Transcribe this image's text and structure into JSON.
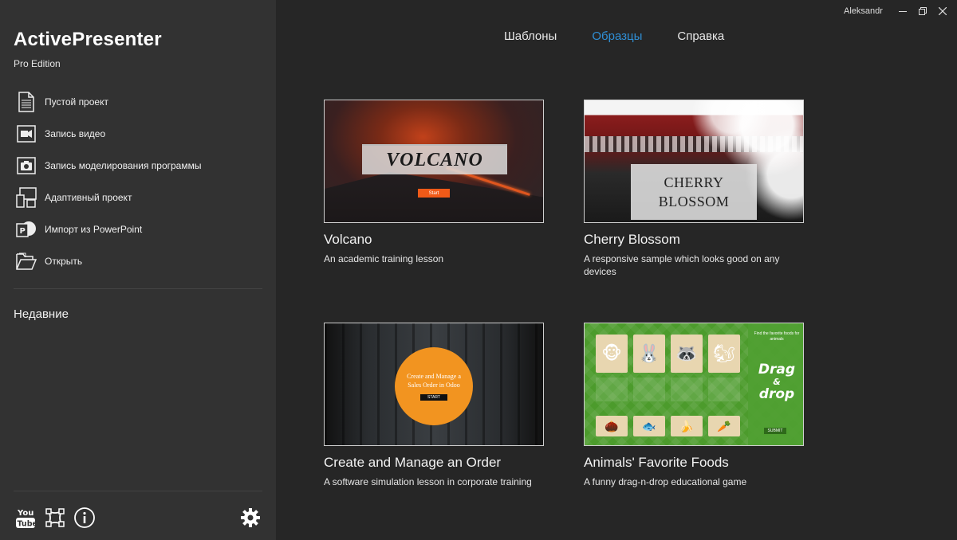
{
  "sidebar": {
    "app_title": "ActivePresenter",
    "edition": "Pro Edition",
    "menu": [
      {
        "label": "Пустой проект",
        "icon": "blank-document-icon"
      },
      {
        "label": "Запись видео",
        "icon": "video-camera-icon"
      },
      {
        "label": "Запись моделирования программы",
        "icon": "photo-camera-icon"
      },
      {
        "label": "Адаптивный проект",
        "icon": "responsive-devices-icon"
      },
      {
        "label": "Импорт из PowerPoint",
        "icon": "powerpoint-icon"
      },
      {
        "label": "Открыть",
        "icon": "open-folder-icon"
      }
    ],
    "recent_label": "Недавние",
    "bottom_icons": [
      "youtube-icon",
      "vector-shape-icon",
      "info-icon",
      "gear-icon"
    ]
  },
  "window": {
    "username": "Aleksandr",
    "controls": [
      "minimize-icon",
      "restore-icon",
      "close-icon"
    ]
  },
  "tabs": [
    {
      "label": "Шаблоны",
      "active": false
    },
    {
      "label": "Образцы",
      "active": true
    },
    {
      "label": "Справка",
      "active": false
    }
  ],
  "accent_color": "#2f8fd6",
  "samples": [
    {
      "title": "Volcano",
      "desc": "An academic training lesson",
      "thumb_text": "VOLCANO",
      "thumb_button": "Start"
    },
    {
      "title": "Cherry Blossom",
      "desc": "A responsive sample which looks good on any devices",
      "thumb_line1": "CHERRY",
      "thumb_line2": "BLOSSOM"
    },
    {
      "title": "Create and Manage an Order",
      "desc": "A software simulation lesson in corporate training",
      "thumb_text": "Create and Manage a Sales Order in Odoo",
      "thumb_button": "START"
    },
    {
      "title": "Animals' Favorite Foods",
      "desc": "A funny drag-n-drop educational game",
      "thumb_line1": "Drag",
      "thumb_line2": "&",
      "thumb_line3": "drop",
      "thumb_instructions": "Find the favorite foods for animals",
      "thumb_button": "SUBMIT"
    }
  ]
}
